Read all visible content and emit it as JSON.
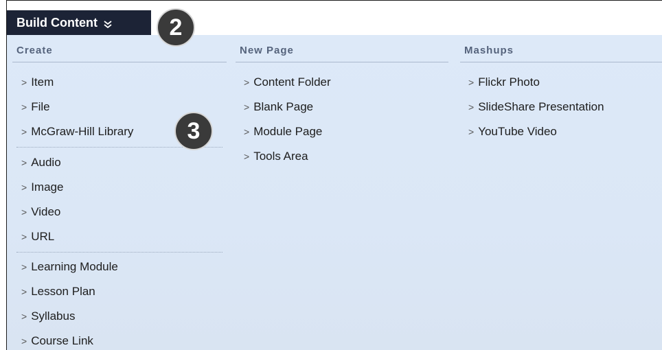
{
  "build_button": {
    "label": "Build Content"
  },
  "badges": {
    "first": "2",
    "second": "3"
  },
  "columns": {
    "create": {
      "heading": "Create",
      "items": [
        "Item",
        "File",
        "McGraw-Hill Library",
        "Audio",
        "Image",
        "Video",
        "URL",
        "Learning Module",
        "Lesson Plan",
        "Syllabus",
        "Course Link"
      ]
    },
    "new_page": {
      "heading": "New Page",
      "items": [
        "Content Folder",
        "Blank Page",
        "Module Page",
        "Tools Area"
      ]
    },
    "mashups": {
      "heading": "Mashups",
      "items": [
        "Flickr Photo",
        "SlideShare Presentation",
        "YouTube Video"
      ]
    }
  },
  "colors": {
    "button_bg": "#1c2336",
    "panel_bg": "#dde9f8",
    "heading_text": "#55637c",
    "badge_bg": "#3a3a3a"
  },
  "icons": {
    "build_chevron": "double-chevron-down-icon",
    "item_marker": "chevron-right-icon"
  }
}
